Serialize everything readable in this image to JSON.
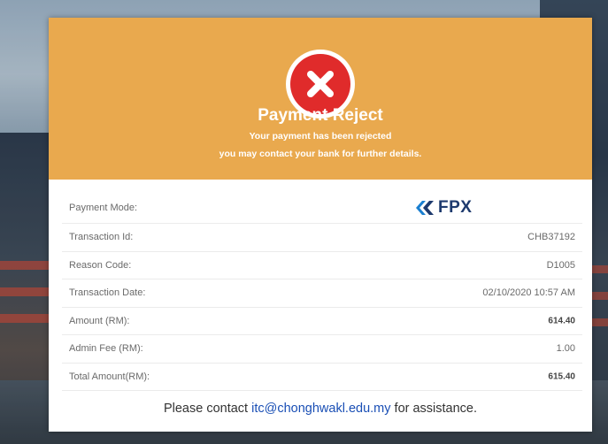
{
  "header": {
    "title": "Payment Reject",
    "subtitle_line1": "Your payment has been rejected",
    "subtitle_line2": "you may contact your bank for further details.",
    "icon": "error-x-icon"
  },
  "details": [
    {
      "label": "Payment Mode:",
      "value": ""
    },
    {
      "label": "Transaction Id:",
      "value": "CHB37192"
    },
    {
      "label": "Reason Code:",
      "value": "D1005"
    },
    {
      "label": "Transaction Date:",
      "value": "02/10/2020 10:57 AM"
    },
    {
      "label": "Amount (RM):",
      "value": "614.40"
    },
    {
      "label": "Admin Fee (RM):",
      "value": "1.00"
    },
    {
      "label": "Total Amount(RM):",
      "value": "615.40"
    }
  ],
  "payment_logo": {
    "text": "FPX",
    "icon": "fpx-logo-icon"
  },
  "footer": {
    "prefix": "Please contact ",
    "email": "itc@chonghwakl.edu.my",
    "suffix": " for assistance."
  },
  "colors": {
    "header_bg": "#e9a94e",
    "error_red": "#e02b2b",
    "link_blue": "#1a4fb5",
    "fpx_navy": "#1e3a6e"
  }
}
